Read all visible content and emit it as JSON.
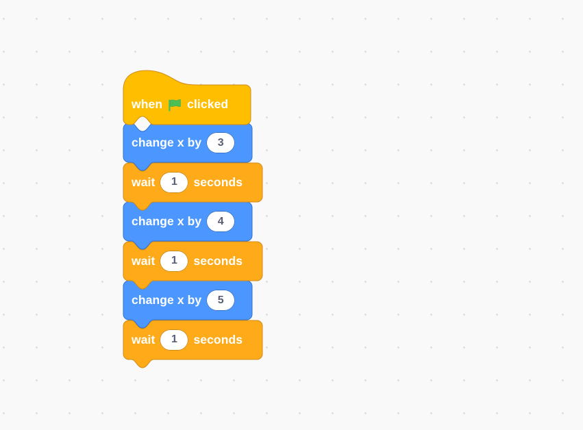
{
  "workspace": {
    "background_color": "#f9f9f9",
    "dot_color": "#dcdcdc",
    "dot_spacing": 48
  },
  "palette": {
    "events_color": "#ffbf00",
    "events_stroke": "#cf8b17",
    "motion_color": "#4c97ff",
    "motion_stroke": "#3373cc",
    "control_color": "#ffab19",
    "control_stroke": "#cf8b17",
    "flag_green": "#4cbf56",
    "flag_green_stroke": "#45a94e",
    "input_text_color": "#575e75",
    "label_color": "#ffffff"
  },
  "script": {
    "name": "green-flag-script",
    "blocks": [
      {
        "id": "when-flag-clicked",
        "type": "hat",
        "category": "events",
        "label_before": "when",
        "icon": "green-flag-icon",
        "label_after": "clicked"
      },
      {
        "id": "change-x-by-1",
        "type": "stack",
        "category": "motion",
        "label_before": "change x by",
        "input_value": "3",
        "label_after": ""
      },
      {
        "id": "wait-seconds-1",
        "type": "stack",
        "category": "control",
        "label_before": "wait",
        "input_value": "1",
        "label_after": "seconds"
      },
      {
        "id": "change-x-by-2",
        "type": "stack",
        "category": "motion",
        "label_before": "change x by",
        "input_value": "4",
        "label_after": ""
      },
      {
        "id": "wait-seconds-2",
        "type": "stack",
        "category": "control",
        "label_before": "wait",
        "input_value": "1",
        "label_after": "seconds"
      },
      {
        "id": "change-x-by-3",
        "type": "stack",
        "category": "motion",
        "label_before": "change x by",
        "input_value": "5",
        "label_after": ""
      },
      {
        "id": "wait-seconds-3",
        "type": "stack",
        "category": "control",
        "label_before": "wait",
        "input_value": "1",
        "label_after": "seconds"
      }
    ]
  }
}
